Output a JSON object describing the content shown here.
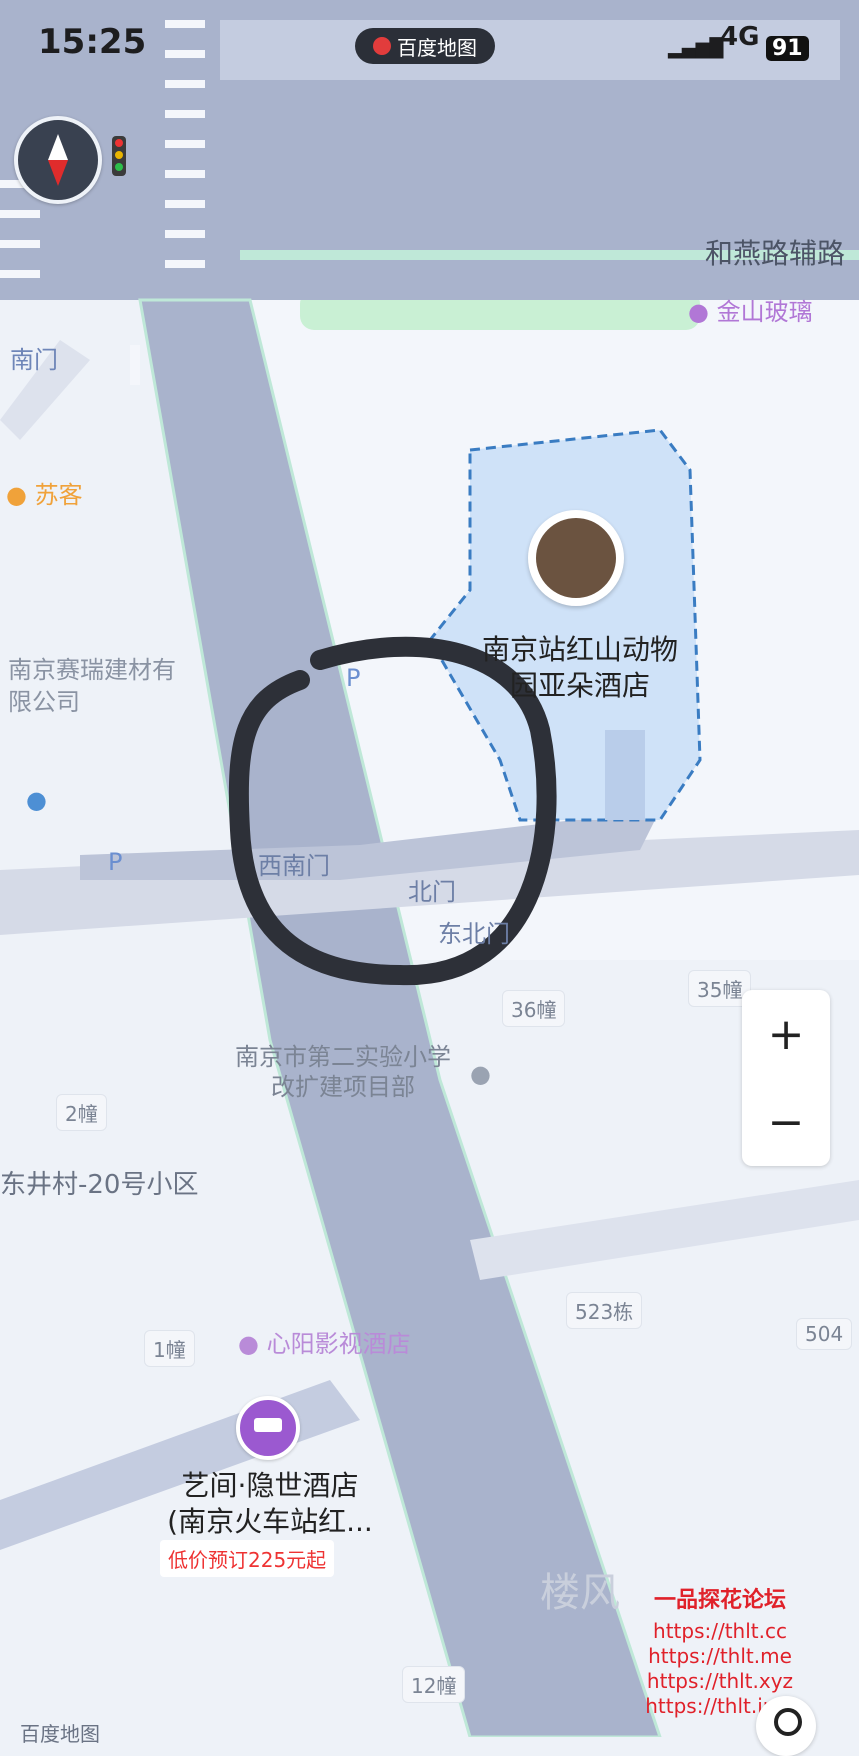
{
  "status_bar": {
    "time": "15:25",
    "app_name": "百度地图",
    "network": "4G",
    "battery": "91"
  },
  "map": {
    "road_label": "和燕路辅路",
    "poi_jinshan": "金山玻璃",
    "poi_suke": "苏客",
    "company": "南京赛瑞建材有限公司",
    "poi_nanmen": "南门",
    "gate_xinan": "西南门",
    "gate_bei": "北门",
    "gate_dongbei": "东北门",
    "building_36": "36幢",
    "building_35": "35幢",
    "building_2": "2幢",
    "building_1": "1幢",
    "building_523": "523栋",
    "building_504": "504",
    "building_12": "12幢",
    "school": "南京市第二实验小学改扩建项目部",
    "community": "东井村-20号小区",
    "hotel_yaduo": "南京站红山动物园亚朵酒店",
    "hotel_xinxin": "心阳影视酒店",
    "hotel_yijian_line1": "艺间·隐世酒店",
    "hotel_yijian_line2": "(南京火车站红...",
    "promo": "低价预订225元起",
    "faded_label": "楼风"
  },
  "controls": {
    "zoom_in": "+",
    "zoom_out": "−"
  },
  "watermark": {
    "title": "一品探花论坛",
    "lines": [
      "https://thlt.cc",
      "https://thlt.me",
      "https://thlt.xyz",
      "https://thlt.info"
    ]
  },
  "bottom": {
    "logo_text": "百度地图"
  },
  "colors": {
    "road": "#a9b3cc",
    "road_edge": "#bfe8d8",
    "background": "#eef2f8",
    "hotel_area": "#cfe2f8",
    "hotel_border": "#3a7cc2",
    "hotel_icon": "#9b59d0"
  }
}
